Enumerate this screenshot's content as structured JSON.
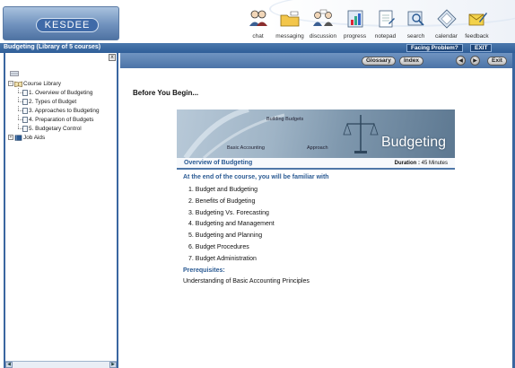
{
  "app": {
    "logo_text": "KESDEE",
    "brand_color": "#3f6aa8"
  },
  "toolbar": {
    "items": [
      {
        "label": "chat",
        "icon": "chat-icon"
      },
      {
        "label": "messaging",
        "icon": "messaging-icon"
      },
      {
        "label": "discussion",
        "icon": "discussion-icon"
      },
      {
        "label": "progress",
        "icon": "progress-icon"
      },
      {
        "label": "notepad",
        "icon": "notepad-icon"
      },
      {
        "label": "search",
        "icon": "search-icon"
      },
      {
        "label": "calendar",
        "icon": "calendar-icon"
      },
      {
        "label": "feedback",
        "icon": "feedback-icon"
      }
    ]
  },
  "title_bar": {
    "title": "Budgeting (Library of 5 courses)",
    "facing_problem": "Facing Problem?",
    "exit": "EXIT"
  },
  "nav": {
    "glossary": "Glossary",
    "index": "Index",
    "prev": "◀",
    "next": "▶",
    "exit": "Exit"
  },
  "tree": {
    "root": "Course Library",
    "items": [
      "1. Overview of Budgeting",
      "2. Types of Budget",
      "3. Approaches to Budgeting",
      "4. Preparation of Budgets",
      "5. Budgetary Control"
    ],
    "aids": "Job Aids",
    "close": "x"
  },
  "content": {
    "heading": "Before You Begin...",
    "banner": {
      "text1": "Building Budgets",
      "text2": "Basic Accounting",
      "text3": "Approach",
      "title": "Budgeting"
    },
    "course_title": "Overview of Budgeting",
    "duration_label": "Duration :",
    "duration_value": "45 Minutes",
    "goal": "At the end of the course, you will be familiar with",
    "topics": [
      "1.  Budget and Budgeting",
      "2.  Benefits of Budgeting",
      "3.  Budgeting Vs. Forecasting",
      "4.  Budgeting and Management",
      "5.  Budgeting and Planning",
      "6.  Budget Procedures",
      "7.  Budget Administration"
    ],
    "prereq_heading": "Prerequisites:",
    "prereq_text": "Understanding of Basic Accounting Principles"
  }
}
